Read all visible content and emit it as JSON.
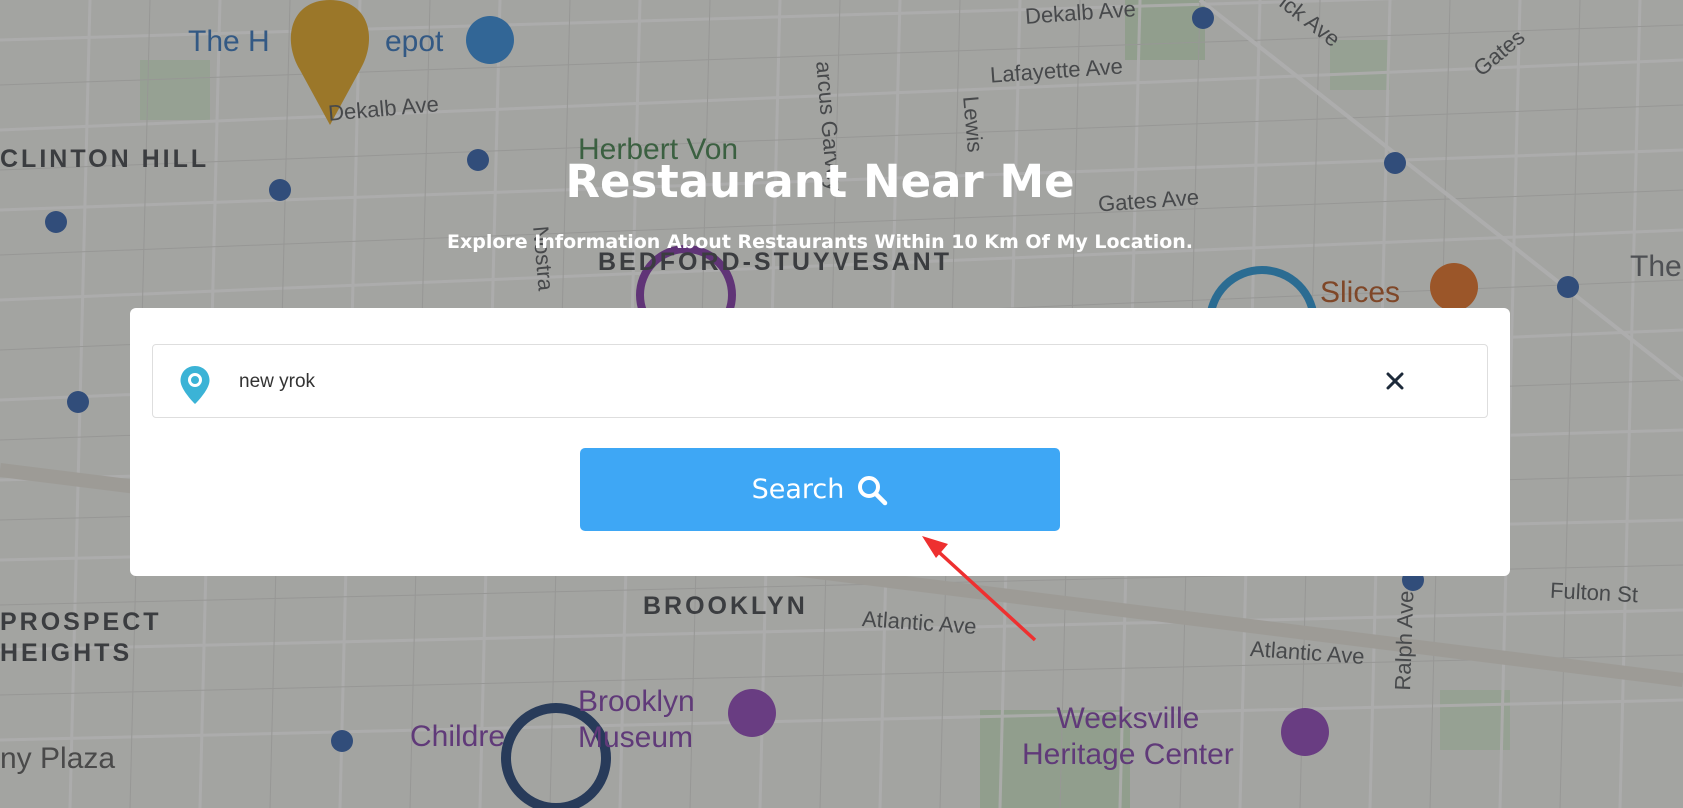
{
  "map": {
    "labels": {
      "home_depot": "The Home Depot",
      "home_depot_visible": "The H",
      "home_depot_visible_end": "epot",
      "dekalb_ave_1": "Dekalb Ave",
      "dekalb_ave_2": "Dekalb Ave",
      "clinton_hill": "CLINTON HILL",
      "herbert_von": "Herbert Von",
      "lafayette_ave": "Lafayette Ave",
      "marcus_garvey": "arcus Garvey",
      "lewis": "Lewis",
      "gates_ave_1": "Gates Ave",
      "gates_ave_2": "Gates",
      "bed_stuy": "BEDFORD-STUYVESANT",
      "wyckoff": "ick Ave",
      "slices": "Slices",
      "the_right": "The",
      "nostrand": "Nostra",
      "brooklyn": "BROOKLYN",
      "atlantic_ave_1": "Atlantic Ave",
      "atlantic_ave_2": "Atlantic Ave",
      "fulton_st": "Fulton St",
      "prospect_heights": "PROSPECT\nHEIGHTS",
      "brooklyn_museum": "Brooklyn\nMuseum",
      "childrens": "Childre",
      "weeksville": "Weeksville\nHeritage Center",
      "ny_plaza": "ny Plaza",
      "ralph_ave": "Ralph Ave"
    }
  },
  "hero": {
    "title": "Restaurant Near Me",
    "subtitle": "Explore Information About Restaurants Within 10 Km Of My Location."
  },
  "search": {
    "value": "new yrok",
    "button_label": "Search"
  },
  "icons": {
    "location": "map-pin-icon",
    "clear": "close-icon",
    "search": "search-icon"
  },
  "colors": {
    "button": "#3ea7f5",
    "pin": "#3bb3d6",
    "clear": "#1d2a3a",
    "arrow": "#ee3030"
  }
}
